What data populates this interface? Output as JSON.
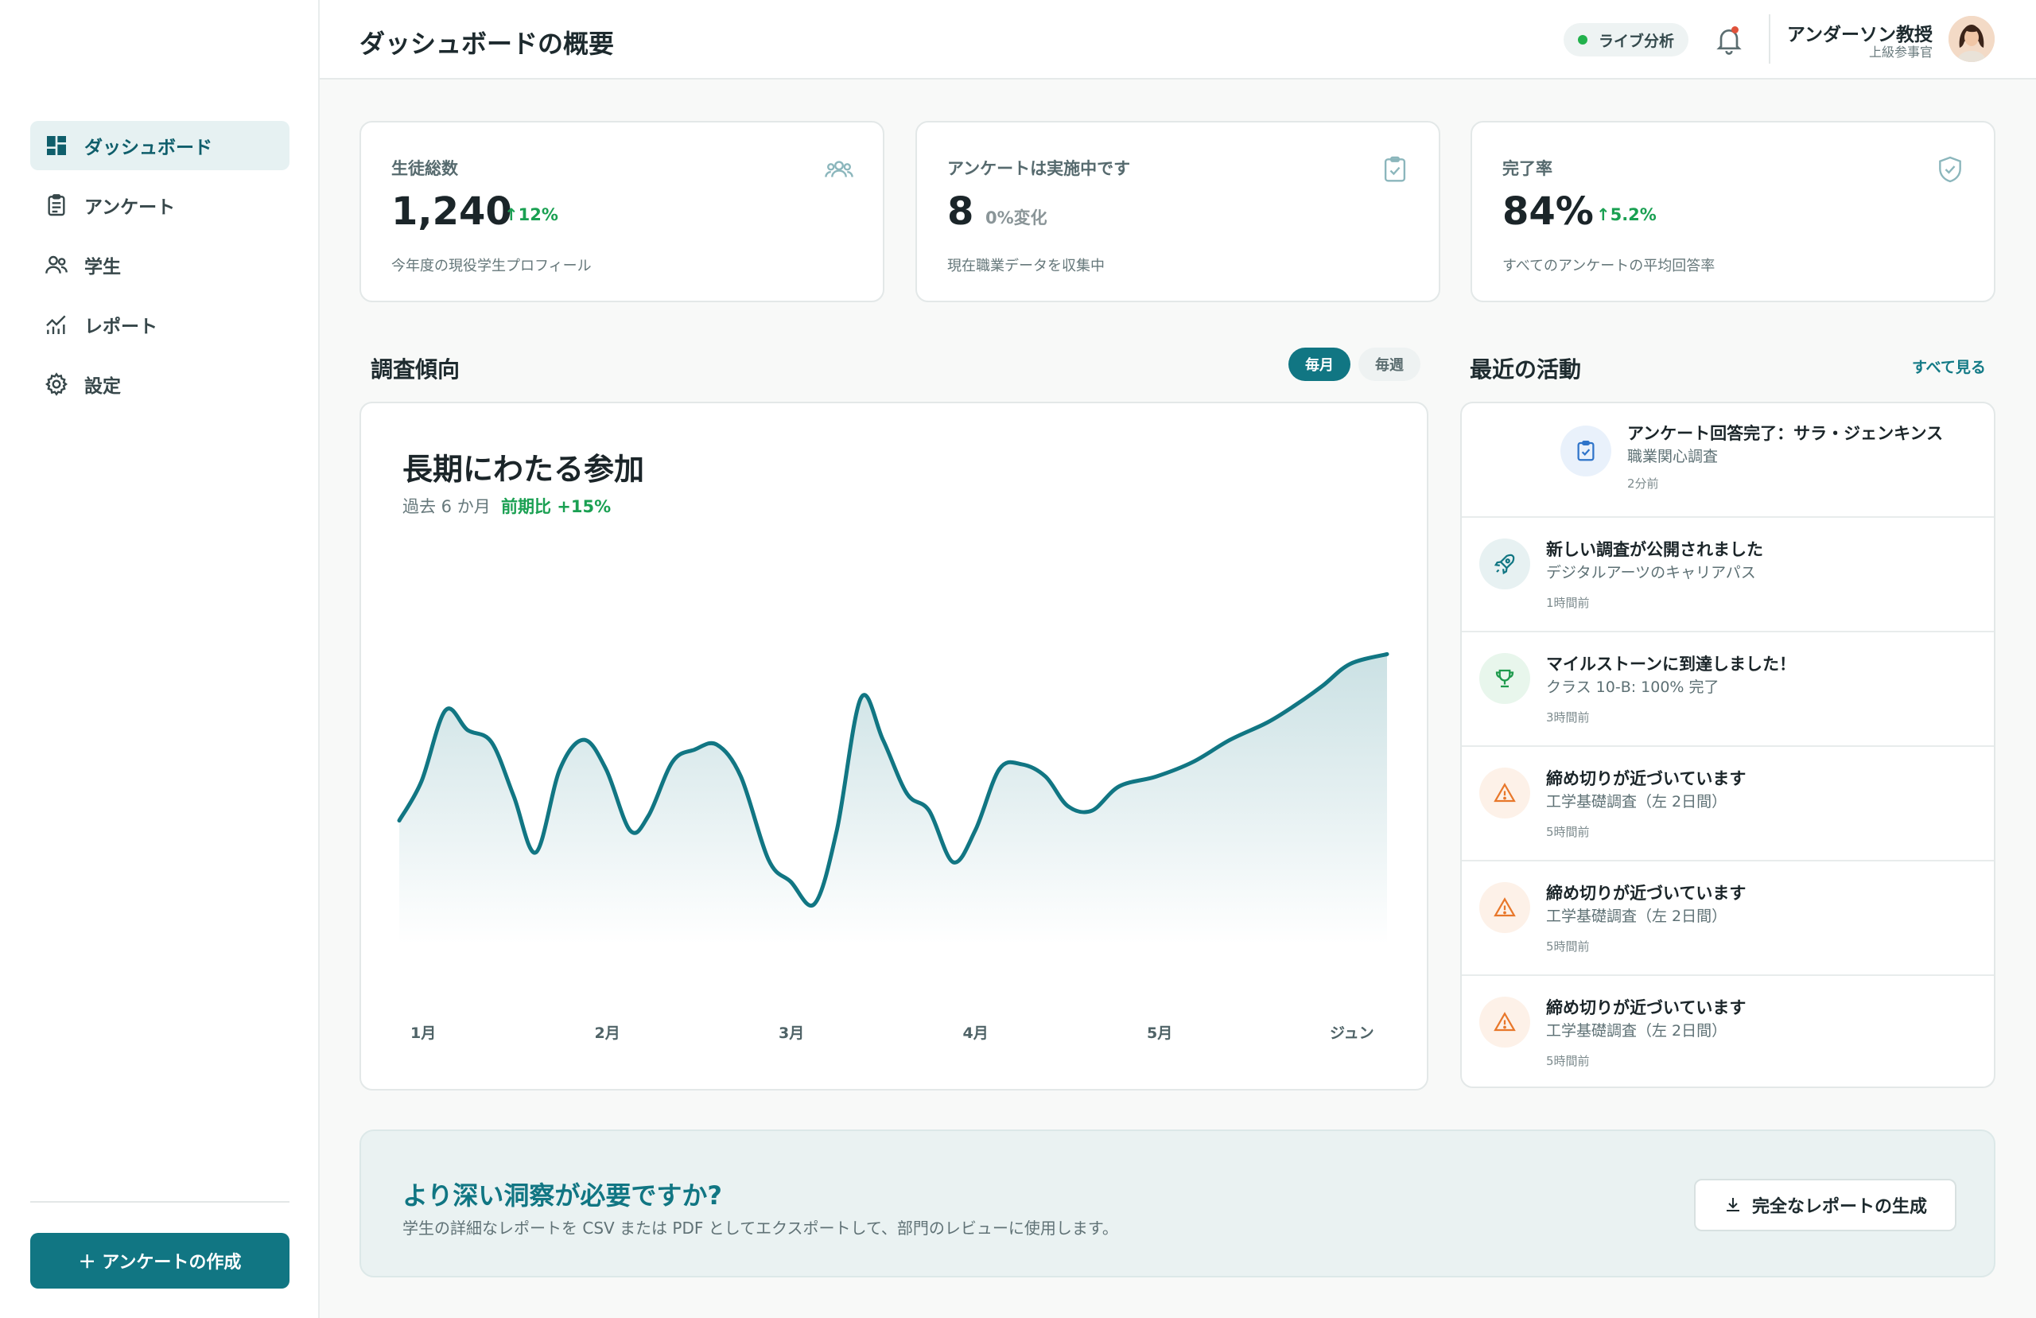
{
  "sidebar": {
    "items": [
      {
        "label": "ダッシュボード",
        "icon": "dashboard-icon",
        "active": true
      },
      {
        "label": "アンケート",
        "icon": "clipboard-icon"
      },
      {
        "label": "学生",
        "icon": "users-icon"
      },
      {
        "label": "レポート",
        "icon": "chart-icon"
      },
      {
        "label": "設定",
        "icon": "gear-icon"
      }
    ],
    "create_button": "＋ アンケートの作成"
  },
  "header": {
    "title": "ダッシュボードの概要",
    "live_label": "ライブ分析",
    "user_name": "アンダーソン教授",
    "user_role": "上級参事官"
  },
  "stats": [
    {
      "label": "生徒総数",
      "value": "1,240",
      "change": "↑12%",
      "desc": "今年度の現役学生プロフィール",
      "icon": "users-icon"
    },
    {
      "label": "アンケートは実施中です",
      "value": "8",
      "change": "0%変化",
      "desc": "現在職業データを収集中",
      "icon": "clipboard-check-icon"
    },
    {
      "label": "完了率",
      "value": "84%",
      "change": "↑5.2%",
      "desc": "すべてのアンケートの平均回答率",
      "icon": "shield-check-icon"
    }
  ],
  "trends": {
    "section_title": "調査傾向",
    "toggle_monthly": "毎月",
    "toggle_weekly": "毎週",
    "card_title": "長期にわたる参加",
    "subtitle": "過去 6 か月",
    "delta": "前期比 +15%"
  },
  "chart_data": {
    "type": "area",
    "categories": [
      "1月",
      "2月",
      "3月",
      "4月",
      "5月",
      "ジュン"
    ],
    "x": [
      0,
      0.12,
      0.25,
      0.37,
      0.5,
      0.62,
      0.74,
      0.87,
      1.0,
      1.12,
      1.25,
      1.35,
      1.48,
      1.6,
      1.72,
      1.85,
      2.0,
      2.12,
      2.25,
      2.37,
      2.5,
      2.62,
      2.75,
      2.87,
      3.0,
      3.12,
      3.25,
      3.37,
      3.5,
      3.62,
      3.75,
      3.9,
      4.1,
      4.3,
      4.5,
      4.7,
      4.85,
      5.0,
      5.15,
      5.35
    ],
    "values": [
      44,
      60,
      89,
      81,
      76,
      54,
      31,
      65,
      77,
      65,
      40,
      46,
      68,
      73,
      75,
      62,
      28,
      19,
      10,
      40,
      94,
      77,
      55,
      48,
      27,
      40,
      65,
      67,
      62,
      50,
      48,
      58,
      62,
      68,
      77,
      84,
      91,
      99,
      108,
      112
    ],
    "y_display_note": "",
    "grid": false,
    "ylim": [
      0,
      130
    ]
  },
  "activity": {
    "section_title": "最近の活動",
    "see_all": "すべて見る",
    "items": [
      {
        "title": "アンケート回答完了：サラ・ジェンキンス",
        "sub": "職業関心調査",
        "time": "2分前",
        "icon": "clipboard-check-icon",
        "color": "#2f74c9",
        "bg": "#e9f1fb"
      },
      {
        "title": "新しい調査が公開されました",
        "sub": "デジタルアーツのキャリアパス",
        "time": "1時間前",
        "icon": "rocket-icon",
        "color": "#117683",
        "bg": "#e7f1f2"
      },
      {
        "title": "マイルストーンに到達しました！",
        "sub": "クラス 10-B: 100% 完了",
        "time": "3時間前",
        "icon": "trophy-icon",
        "color": "#1e9a4c",
        "bg": "#e8f6ec"
      },
      {
        "title": "締め切りが近づいています",
        "sub": "工学基礎調査（左 2日間）",
        "time": "5時間前",
        "icon": "warning-icon",
        "color": "#e8772a",
        "bg": "#fdf1e8"
      },
      {
        "title": "締め切りが近づいています",
        "sub": "工学基礎調査（左 2日間）",
        "time": "5時間前",
        "icon": "warning-icon",
        "color": "#e8772a",
        "bg": "#fdf1e8"
      },
      {
        "title": "締め切りが近づいています",
        "sub": "工学基礎調査（左 2日間）",
        "time": "5時間前",
        "icon": "warning-icon",
        "color": "#e8772a",
        "bg": "#fdf1e8"
      }
    ]
  },
  "banner": {
    "title": "より深い洞察が必要ですか?",
    "text": "学生の詳細なレポートを CSV または PDF としてエクスポートして、部門のレビューに使用します。",
    "button": "完全なレポートの生成"
  },
  "colors": {
    "accent": "#117683",
    "positive": "#1aa052",
    "warning": "#e8772a"
  }
}
